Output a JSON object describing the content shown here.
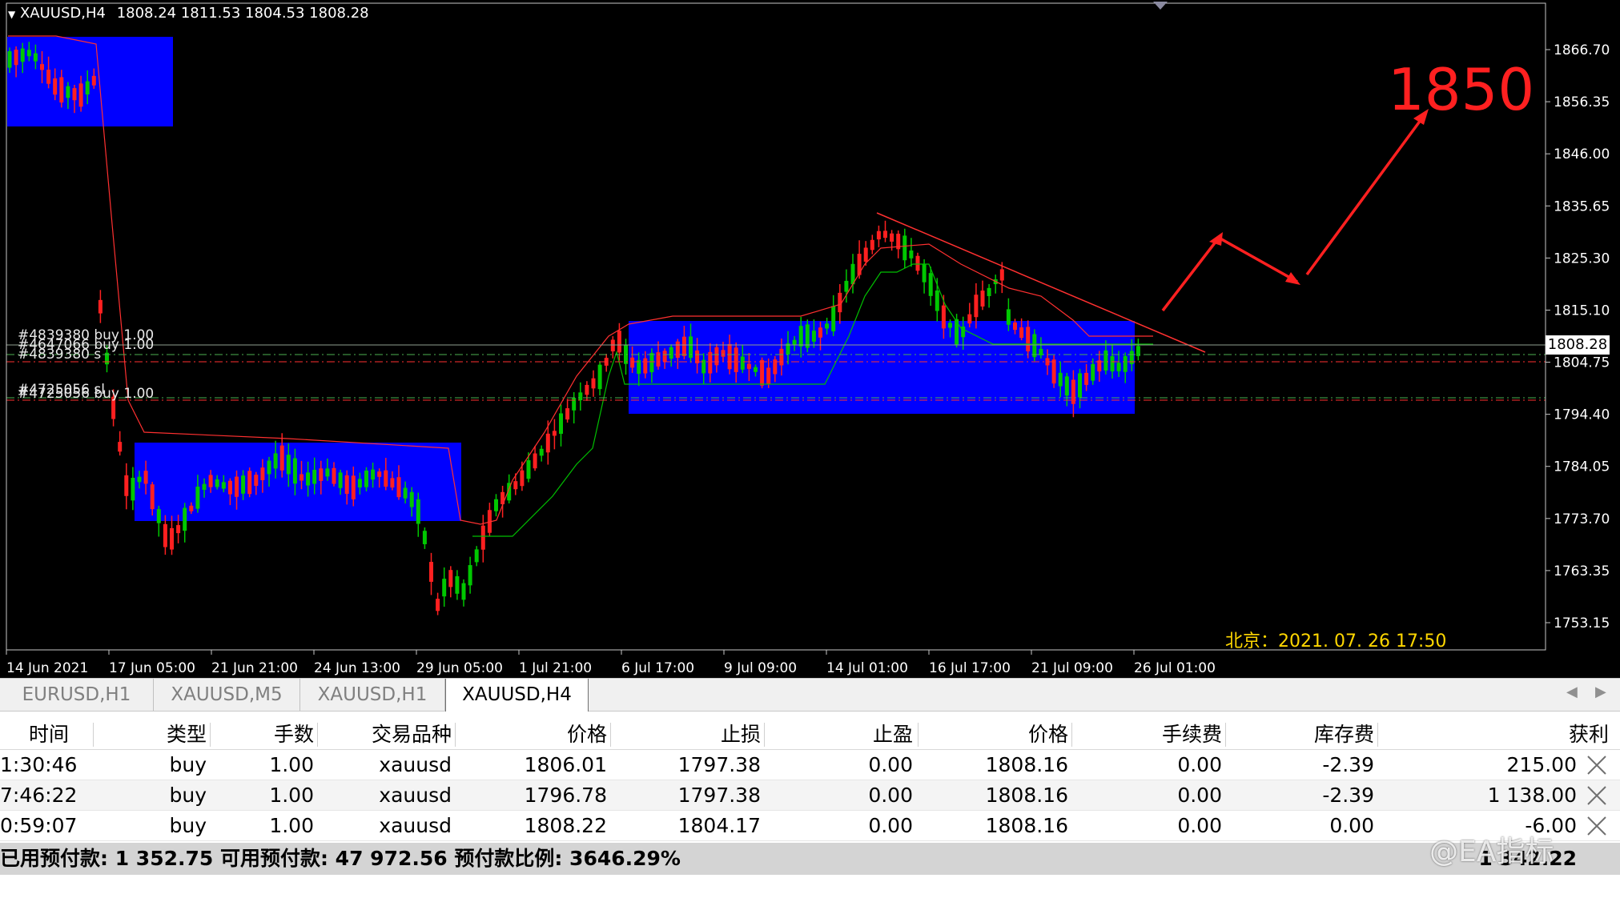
{
  "chart": {
    "header_symbol": "XAUUSD,H4",
    "header_ohlc": "1808.24 1811.53 1804.53 1808.28",
    "current_price": "1808.28",
    "price_labels": [
      "1866.70",
      "1856.35",
      "1846.00",
      "1835.65",
      "1825.30",
      "1815.10",
      "1804.75",
      "1794.40",
      "1784.05",
      "1773.70",
      "1763.35",
      "1753.15"
    ],
    "time_labels": [
      "14 Jun 2021",
      "17 Jun 05:00",
      "21 Jun 21:00",
      "24 Jun 13:00",
      "29 Jun 05:00",
      "1 Jul 21:00",
      "6 Jul 17:00",
      "9 Jul 09:00",
      "14 Jul 01:00",
      "16 Jul 17:00",
      "21 Jul 09:00",
      "26 Jul 01:00"
    ],
    "order_labels": [
      "#4839380 buy 1.00",
      "#4647066 buy 1.00",
      "#4839380 s",
      "#4725056 sl",
      "#4725056 buy 1.00"
    ],
    "target_annotation": "1850",
    "beijing_time": "北京：2021. 07. 26  17:50",
    "colors": {
      "background": "#000000",
      "bull": "#00c800",
      "bear": "#ff2020",
      "zone": "#0000ff",
      "annotation": "#ff2020",
      "timestamp": "#ffd700"
    }
  },
  "tabs": [
    {
      "label": "EURUSD,H1",
      "active": false
    },
    {
      "label": "XAUUSD,M5",
      "active": false
    },
    {
      "label": "XAUUSD,H1",
      "active": false
    },
    {
      "label": "XAUUSD,H4",
      "active": true
    }
  ],
  "table": {
    "headers": [
      "时间",
      "类型",
      "手数",
      "交易品种",
      "价格",
      "止损",
      "止盈",
      "价格",
      "手续费",
      "库存费",
      "获利"
    ],
    "rows": [
      [
        "1:30:46",
        "buy",
        "1.00",
        "xauusd",
        "1806.01",
        "1797.38",
        "0.00",
        "1808.16",
        "0.00",
        "-2.39",
        "215.00"
      ],
      [
        "7:46:22",
        "buy",
        "1.00",
        "xauusd",
        "1796.78",
        "1797.38",
        "0.00",
        "1808.16",
        "0.00",
        "-2.39",
        "1 138.00"
      ],
      [
        "0:59:07",
        "buy",
        "1.00",
        "xauusd",
        "1808.22",
        "1804.17",
        "0.00",
        "1808.16",
        "0.00",
        "0.00",
        "-6.00"
      ]
    ],
    "summary_text": "已用预付款: 1 352.75  可用预付款: 47 972.56  预付款比例: 3646.29%",
    "summary_profit": "1 342.22"
  },
  "watermark": "@EA指标"
}
